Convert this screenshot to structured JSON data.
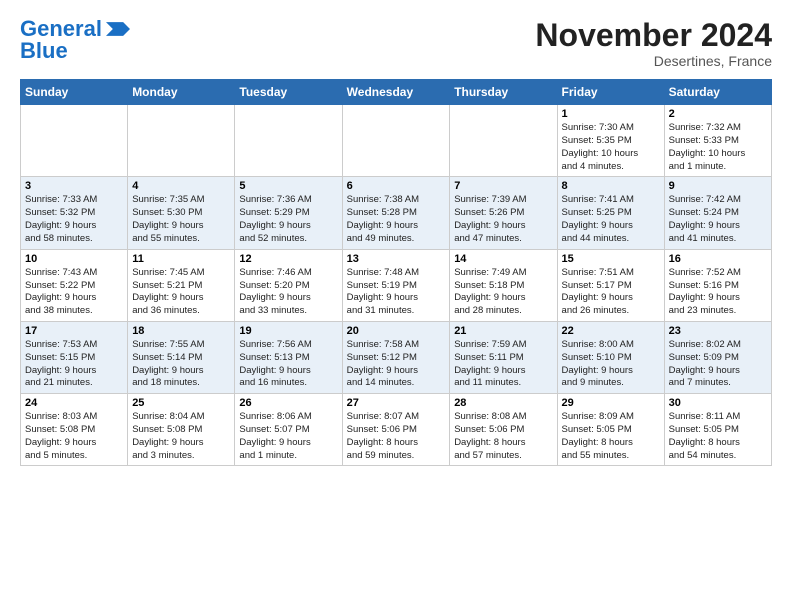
{
  "logo": {
    "line1": "General",
    "line2": "Blue",
    "arrow_color": "#1a6fc4"
  },
  "header": {
    "month_title": "November 2024",
    "subtitle": "Desertines, France"
  },
  "weekdays": [
    "Sunday",
    "Monday",
    "Tuesday",
    "Wednesday",
    "Thursday",
    "Friday",
    "Saturday"
  ],
  "weeks": [
    {
      "row_class": "row-odd",
      "days": [
        {
          "num": "",
          "info": ""
        },
        {
          "num": "",
          "info": ""
        },
        {
          "num": "",
          "info": ""
        },
        {
          "num": "",
          "info": ""
        },
        {
          "num": "",
          "info": ""
        },
        {
          "num": "1",
          "info": "Sunrise: 7:30 AM\nSunset: 5:35 PM\nDaylight: 10 hours\nand 4 minutes."
        },
        {
          "num": "2",
          "info": "Sunrise: 7:32 AM\nSunset: 5:33 PM\nDaylight: 10 hours\nand 1 minute."
        }
      ]
    },
    {
      "row_class": "row-even",
      "days": [
        {
          "num": "3",
          "info": "Sunrise: 7:33 AM\nSunset: 5:32 PM\nDaylight: 9 hours\nand 58 minutes."
        },
        {
          "num": "4",
          "info": "Sunrise: 7:35 AM\nSunset: 5:30 PM\nDaylight: 9 hours\nand 55 minutes."
        },
        {
          "num": "5",
          "info": "Sunrise: 7:36 AM\nSunset: 5:29 PM\nDaylight: 9 hours\nand 52 minutes."
        },
        {
          "num": "6",
          "info": "Sunrise: 7:38 AM\nSunset: 5:28 PM\nDaylight: 9 hours\nand 49 minutes."
        },
        {
          "num": "7",
          "info": "Sunrise: 7:39 AM\nSunset: 5:26 PM\nDaylight: 9 hours\nand 47 minutes."
        },
        {
          "num": "8",
          "info": "Sunrise: 7:41 AM\nSunset: 5:25 PM\nDaylight: 9 hours\nand 44 minutes."
        },
        {
          "num": "9",
          "info": "Sunrise: 7:42 AM\nSunset: 5:24 PM\nDaylight: 9 hours\nand 41 minutes."
        }
      ]
    },
    {
      "row_class": "row-odd",
      "days": [
        {
          "num": "10",
          "info": "Sunrise: 7:43 AM\nSunset: 5:22 PM\nDaylight: 9 hours\nand 38 minutes."
        },
        {
          "num": "11",
          "info": "Sunrise: 7:45 AM\nSunset: 5:21 PM\nDaylight: 9 hours\nand 36 minutes."
        },
        {
          "num": "12",
          "info": "Sunrise: 7:46 AM\nSunset: 5:20 PM\nDaylight: 9 hours\nand 33 minutes."
        },
        {
          "num": "13",
          "info": "Sunrise: 7:48 AM\nSunset: 5:19 PM\nDaylight: 9 hours\nand 31 minutes."
        },
        {
          "num": "14",
          "info": "Sunrise: 7:49 AM\nSunset: 5:18 PM\nDaylight: 9 hours\nand 28 minutes."
        },
        {
          "num": "15",
          "info": "Sunrise: 7:51 AM\nSunset: 5:17 PM\nDaylight: 9 hours\nand 26 minutes."
        },
        {
          "num": "16",
          "info": "Sunrise: 7:52 AM\nSunset: 5:16 PM\nDaylight: 9 hours\nand 23 minutes."
        }
      ]
    },
    {
      "row_class": "row-even",
      "days": [
        {
          "num": "17",
          "info": "Sunrise: 7:53 AM\nSunset: 5:15 PM\nDaylight: 9 hours\nand 21 minutes."
        },
        {
          "num": "18",
          "info": "Sunrise: 7:55 AM\nSunset: 5:14 PM\nDaylight: 9 hours\nand 18 minutes."
        },
        {
          "num": "19",
          "info": "Sunrise: 7:56 AM\nSunset: 5:13 PM\nDaylight: 9 hours\nand 16 minutes."
        },
        {
          "num": "20",
          "info": "Sunrise: 7:58 AM\nSunset: 5:12 PM\nDaylight: 9 hours\nand 14 minutes."
        },
        {
          "num": "21",
          "info": "Sunrise: 7:59 AM\nSunset: 5:11 PM\nDaylight: 9 hours\nand 11 minutes."
        },
        {
          "num": "22",
          "info": "Sunrise: 8:00 AM\nSunset: 5:10 PM\nDaylight: 9 hours\nand 9 minutes."
        },
        {
          "num": "23",
          "info": "Sunrise: 8:02 AM\nSunset: 5:09 PM\nDaylight: 9 hours\nand 7 minutes."
        }
      ]
    },
    {
      "row_class": "row-odd",
      "days": [
        {
          "num": "24",
          "info": "Sunrise: 8:03 AM\nSunset: 5:08 PM\nDaylight: 9 hours\nand 5 minutes."
        },
        {
          "num": "25",
          "info": "Sunrise: 8:04 AM\nSunset: 5:08 PM\nDaylight: 9 hours\nand 3 minutes."
        },
        {
          "num": "26",
          "info": "Sunrise: 8:06 AM\nSunset: 5:07 PM\nDaylight: 9 hours\nand 1 minute."
        },
        {
          "num": "27",
          "info": "Sunrise: 8:07 AM\nSunset: 5:06 PM\nDaylight: 8 hours\nand 59 minutes."
        },
        {
          "num": "28",
          "info": "Sunrise: 8:08 AM\nSunset: 5:06 PM\nDaylight: 8 hours\nand 57 minutes."
        },
        {
          "num": "29",
          "info": "Sunrise: 8:09 AM\nSunset: 5:05 PM\nDaylight: 8 hours\nand 55 minutes."
        },
        {
          "num": "30",
          "info": "Sunrise: 8:11 AM\nSunset: 5:05 PM\nDaylight: 8 hours\nand 54 minutes."
        }
      ]
    }
  ]
}
